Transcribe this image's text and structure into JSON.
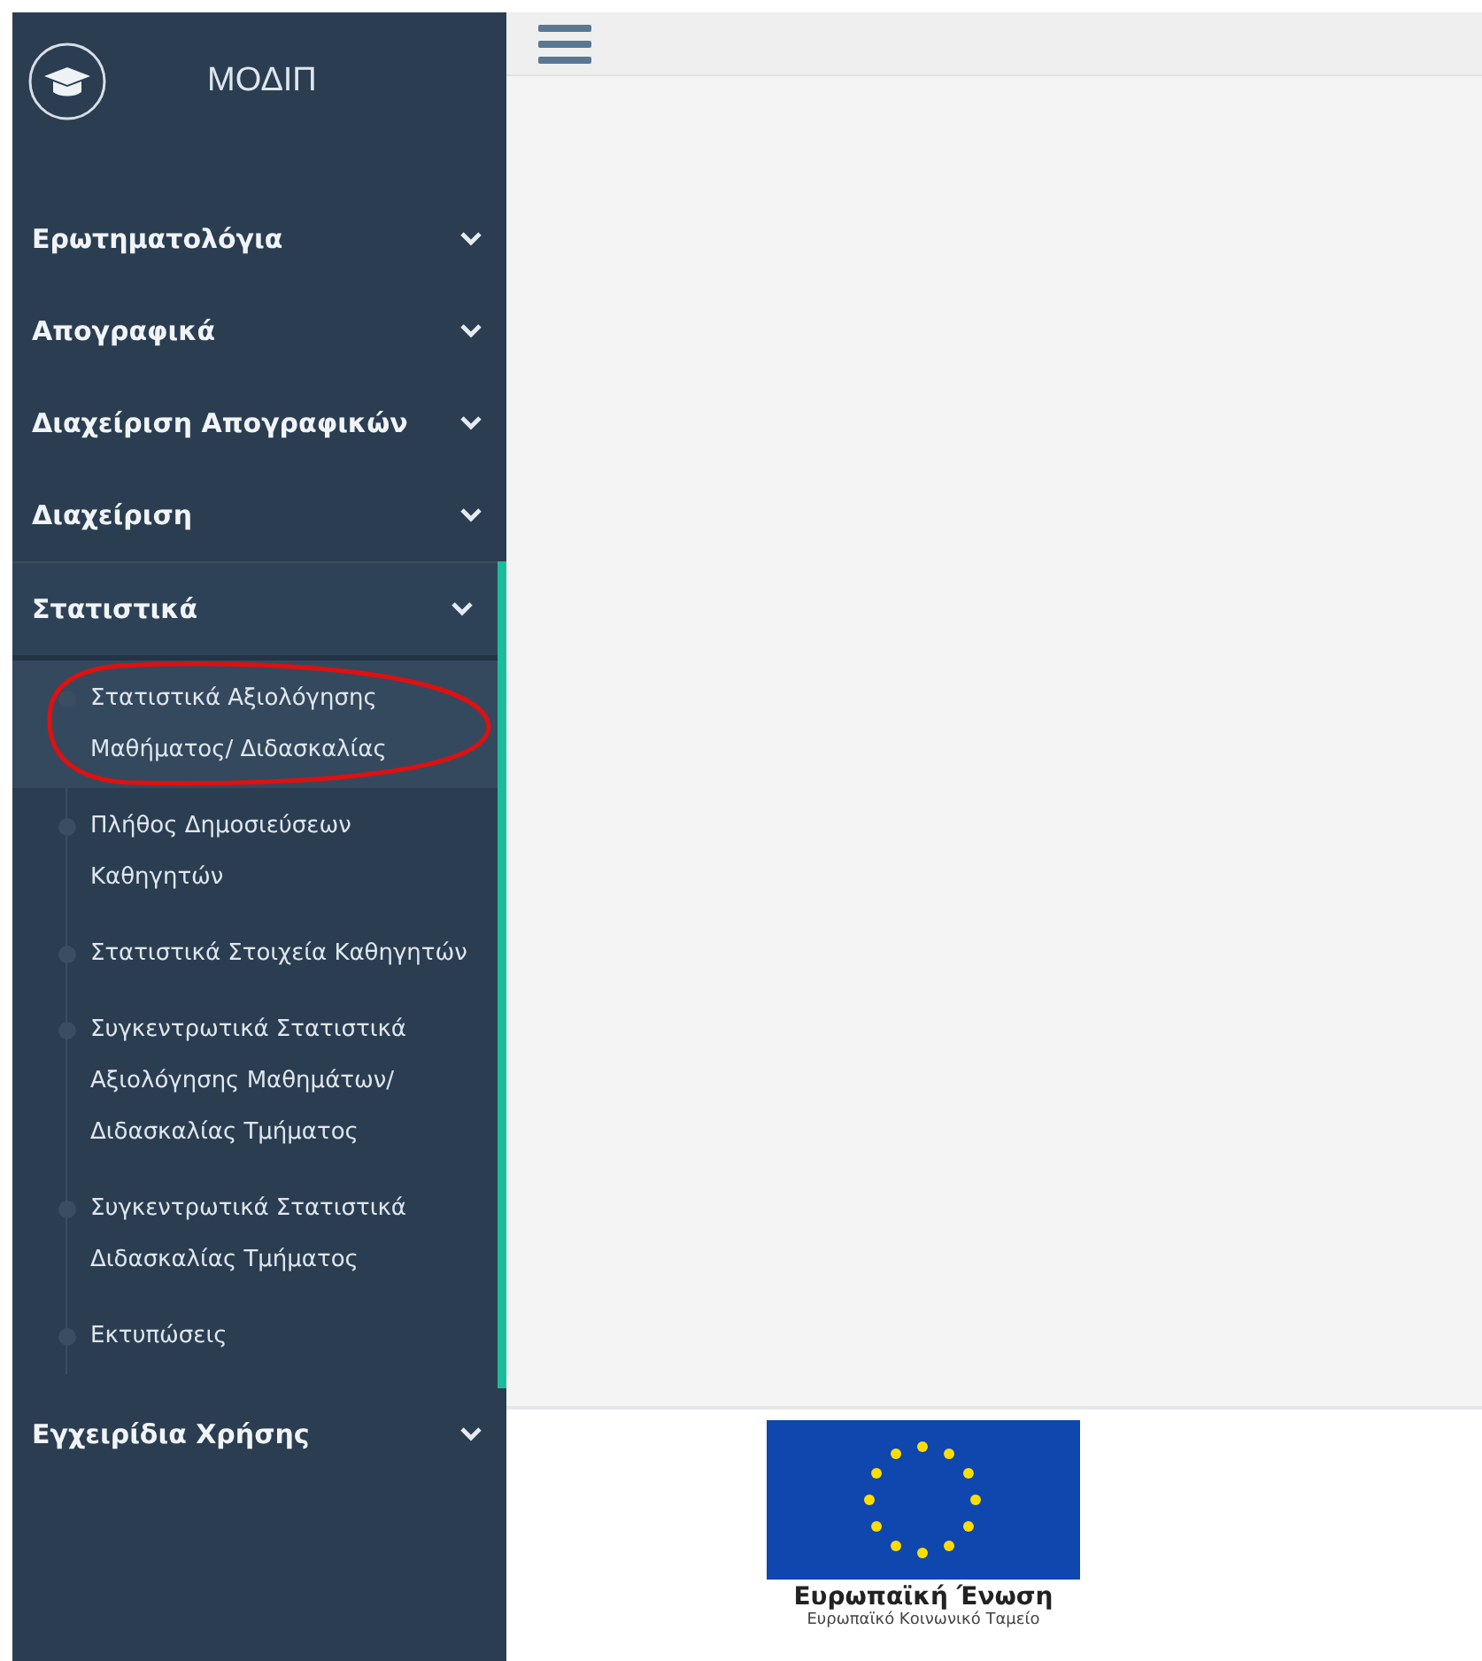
{
  "sidebar": {
    "title": "ΜΟΔΙΠ",
    "items": [
      {
        "label": "Ερωτηματολόγια",
        "expanded": false
      },
      {
        "label": "Απογραφικά",
        "expanded": false
      },
      {
        "label": "Διαχείριση Απογραφικών",
        "expanded": false
      },
      {
        "label": "Διαχείριση",
        "expanded": false
      },
      {
        "label": "Στατιστικά",
        "expanded": true,
        "children": [
          {
            "label": "Στατιστικά Αξιολόγησης Μαθήματος/ Διδασκαλίας",
            "selected": true
          },
          {
            "label": "Πλήθος Δημοσιεύσεων Καθηγητών",
            "selected": false
          },
          {
            "label": "Στατιστικά Στοιχεία Καθηγητών",
            "selected": false
          },
          {
            "label": "Συγκεντρωτικά Στατιστικά Αξιολόγησης Μαθημάτων/ Διδασκαλίας Τμήματος",
            "selected": false
          },
          {
            "label": "Συγκεντρωτικά Στατιστικά Διδασκαλίας Τμήματος",
            "selected": false
          },
          {
            "label": "Εκτυπώσεις",
            "selected": false
          }
        ]
      },
      {
        "label": "Εγχειρίδια Χρήσης",
        "expanded": false
      }
    ]
  },
  "footer": {
    "logo_title": "Ευρωπαϊκή Ένωση",
    "logo_subtitle": "Ευρωπαϊκό Κοινωνικό Ταμείο"
  }
}
